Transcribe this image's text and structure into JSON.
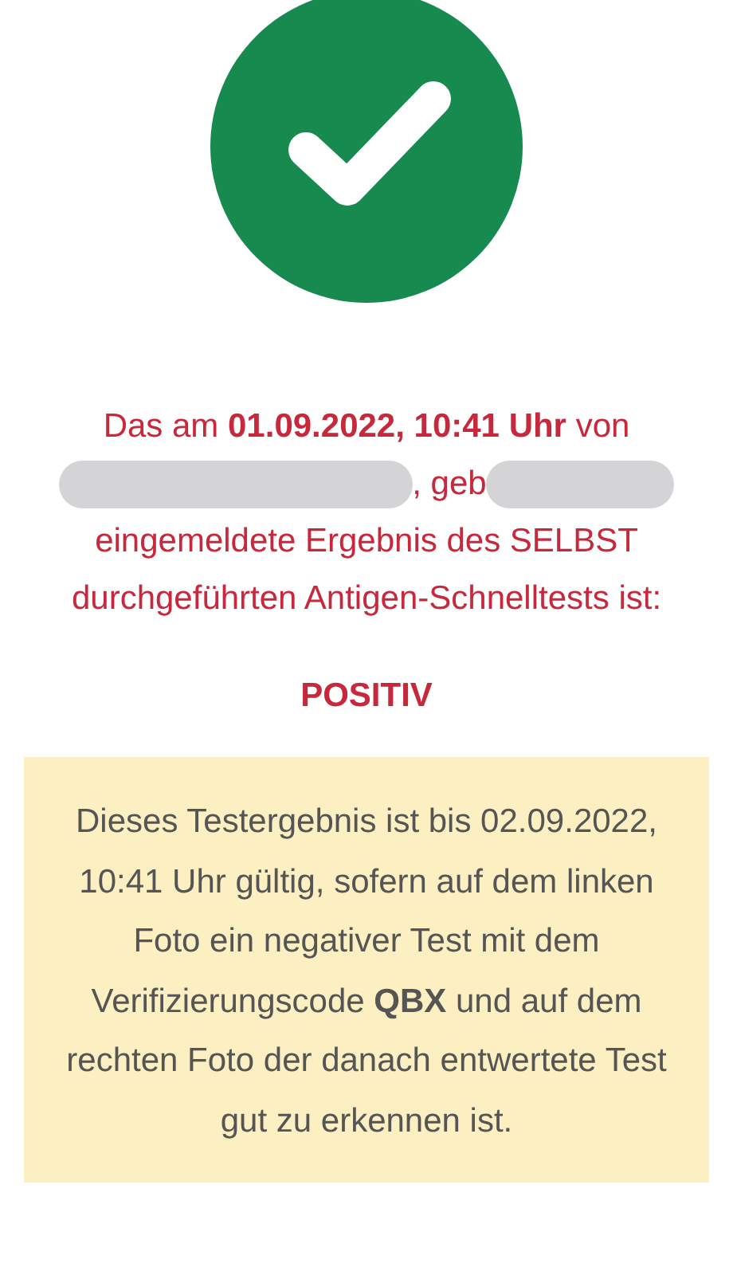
{
  "status_icon": {
    "kind": "success"
  },
  "result_text": {
    "line_1": "Das am **01.09.2022, 10:41 Uhr** von",
    "between_redactions": ", geb",
    "line_3": "eingemeldete Ergebnis des SELBST durchgeführten Antigen-Schnelltests ist:"
  },
  "result": "POSITIV",
  "notice": "Dieses Testergebnis ist bis 02.09.2022, 10:41 Uhr gültig, sofern auf dem linken Foto ein negativer Test mit dem Verifizierungscode **QBX** und auf dem rechten Foto der danach entwertete Test gut zu erkennen ist."
}
